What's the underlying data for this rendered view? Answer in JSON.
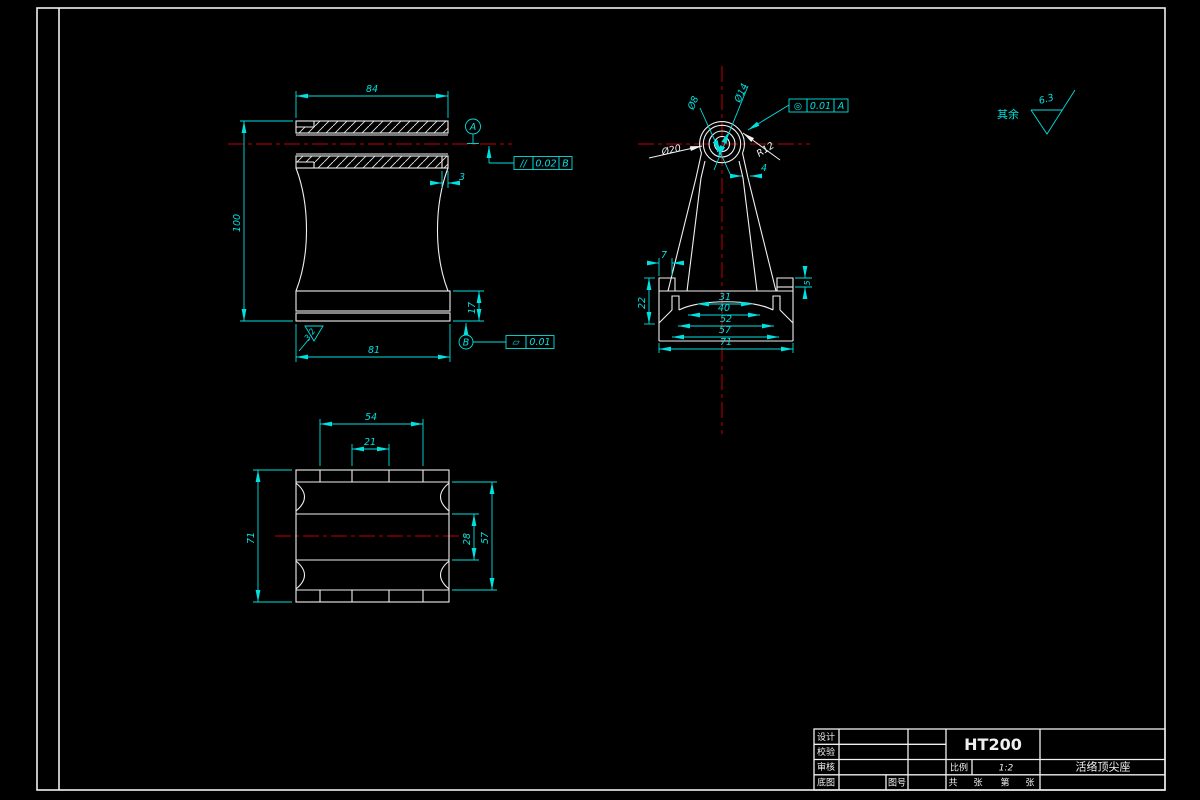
{
  "drawing": {
    "colors": {
      "background": "#000000",
      "geometry": "#F0F0F0",
      "dimension": "#00E0E0",
      "centerline": "#BF0000"
    },
    "general_note": {
      "label": "其余",
      "roughness": "6.3"
    },
    "front_view": {
      "dim_width_top": "84",
      "dim_height": "100",
      "dim_step": "3",
      "dim_base_width": "81",
      "dim_base_height": "17",
      "roughness_bottom": "3.2",
      "datum_axis": "A",
      "datum_base": "B",
      "parallelism": {
        "symbol": "//",
        "value": "0.02",
        "datum": "B"
      },
      "flatness": {
        "symbol": "▱",
        "value": "0.01"
      }
    },
    "side_view": {
      "dim_bore_small": "Ø8",
      "dim_bore": "Ø14",
      "dim_outer": "Ø20",
      "dim_radius": "R12",
      "dim_wall": "4",
      "dim_ear": "7",
      "dim_base_height": "22",
      "dim_rim": "5",
      "dim_slot": "31",
      "dim_channel_1": "40",
      "dim_channel_2": "52",
      "dim_channel_3": "57",
      "dim_base_width": "71",
      "concentricity": {
        "symbol": "◎",
        "value": "0.01",
        "datum": "A"
      }
    },
    "bottom_view": {
      "dim_tab_outer": "54",
      "dim_tab_inner": "21",
      "dim_height": "71",
      "dim_mid": "28",
      "dim_flange": "57"
    },
    "title_block": {
      "rows": {
        "r1": "设计",
        "r2": "校验",
        "r3": "审核",
        "r4": "底图",
        "r4b": "图号"
      },
      "material": "HT200",
      "scale_label": "比例",
      "scale_value": "1:2",
      "part_name": "活络顶尖座",
      "sheet": {
        "total_label": "共",
        "total_unit": "张",
        "no_label": "第",
        "no_unit": "张"
      }
    }
  }
}
